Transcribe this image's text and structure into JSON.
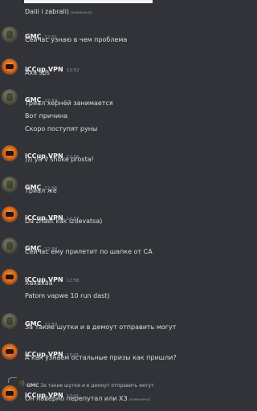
{
  "top": {
    "text": "Dalii i zabrali)",
    "edited": "(изменено)"
  },
  "messages": [
    {
      "author": "GMC",
      "time": "12:51",
      "lines": [
        "Сейчас узнаю в чем проблема"
      ]
    },
    {
      "author": "iCCup.VPN",
      "time": "12:52",
      "lines": [
        "Аха sps"
      ]
    },
    {
      "author": "GMC",
      "time": "12:54",
      "lines": [
        "Триал хернёй занимается",
        "Вот причина",
        "Скоро поступят руны"
      ]
    },
    {
      "author": "iCCup.VPN",
      "time": "12:56",
      "lines": [
        "))) ya v shoke prosta!"
      ]
    },
    {
      "author": "GMC",
      "time": "12:56",
      "lines": [
        "Триал же"
      ]
    },
    {
      "author": "iCCup.VPN",
      "time": "12:57",
      "lines": [
        "Da znaet kak izdevatsa)"
      ]
    },
    {
      "author": "GMC",
      "time": "12:58",
      "lines": [
        "Сейчас ему прилетит по шапке от СА"
      ]
    },
    {
      "author": "iCCup.VPN",
      "time": "12:58",
      "lines": [
        "Хахахаа",
        "Patom vapwe 10 run dast)"
      ]
    },
    {
      "author": "GMC",
      "time": "12:59",
      "lines": [
        "За такие шутки и в демоут отправить могут"
      ]
    },
    {
      "author": "iCCup.VPN",
      "time": "13:01",
      "lines": [
        "А как узнаем остальные призы как пришли?"
      ]
    },
    {
      "author": "iCCup.VPN",
      "time": "13:01",
      "lines": [
        "Он наверно перепутал или ХЗ"
      ],
      "edited": "(изменено)"
    }
  ],
  "reply": {
    "author": "GMC",
    "text": "За такие шутки и в демоут отправить могут"
  },
  "colors": {
    "background": "#313338",
    "text": "#dbdee1",
    "muted": "#949ba4",
    "name": "#f2f3f5"
  }
}
